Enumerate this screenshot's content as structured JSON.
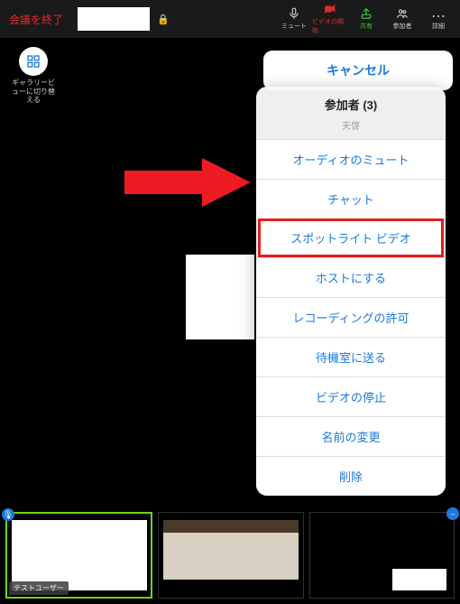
{
  "topbar": {
    "leave": "会議を終了",
    "items": {
      "mute": "ミュート",
      "video": "ビデオの開始",
      "share": "共有",
      "participants": "参加者",
      "more": "詳細"
    }
  },
  "gallery_toggle": "ギャラリービューに切り替える",
  "sheet": {
    "title": "参加者 (3)",
    "sub": "天啓",
    "items": [
      "オーディオのミュート",
      "チャット",
      "スポットライト ビデオ",
      "ホストにする",
      "レコーディングの許可",
      "待機室に送る",
      "ビデオの停止",
      "名前の変更",
      "削除"
    ],
    "highlight_index": 2,
    "cancel": "キャンセル"
  },
  "filmstrip": {
    "active_index": 0,
    "thumbs": [
      {
        "name": "テストユーザー"
      },
      {
        "name": ""
      },
      {
        "name": ""
      }
    ],
    "left_badge": "🎙",
    "right_badge": "–"
  }
}
